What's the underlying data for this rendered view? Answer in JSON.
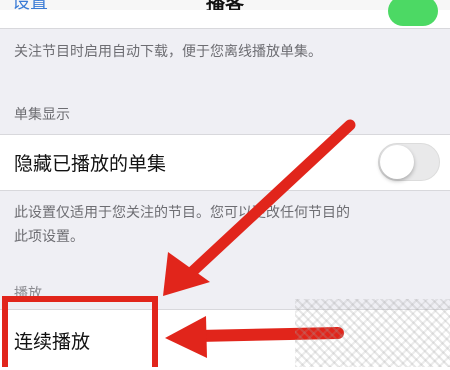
{
  "nav": {
    "back_label": "设置",
    "title": "播客"
  },
  "auto_download_footer": "关注节目时启用自动下载，便于您离线播放单集。",
  "episode_display": {
    "header": "单集显示",
    "hide_played_label": "隐藏已播放的单集",
    "hide_played_on": false,
    "footer_line1": "此设置仅适用于您关注的节目。您可以更改任何节目的",
    "footer_line2": "此项设置。"
  },
  "playback": {
    "header": "播放",
    "continuous_label": "连续播放"
  },
  "colors": {
    "annotation_red": "#e1251b",
    "toggle_on": "#4cd964",
    "link_blue": "#3a7bd5"
  }
}
